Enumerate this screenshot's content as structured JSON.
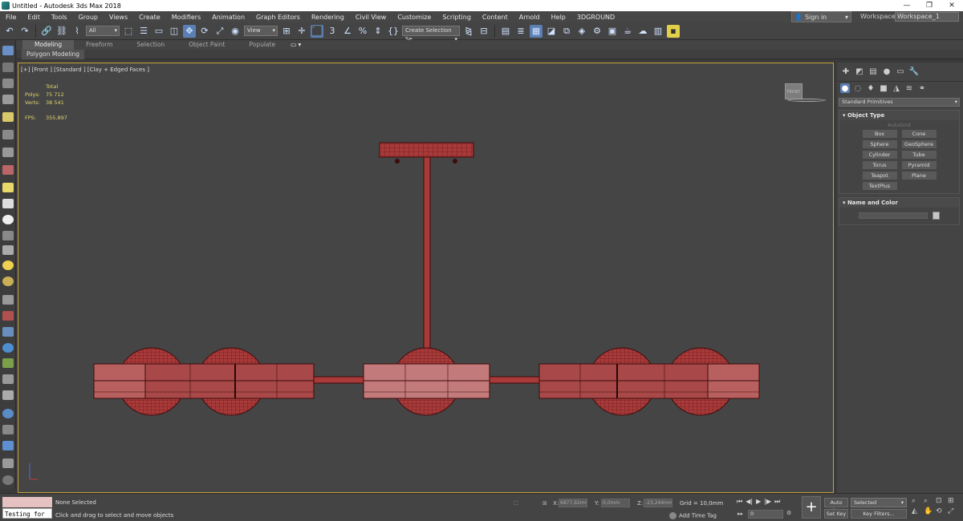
{
  "window": {
    "title": "Untitled - Autodesk 3ds Max 2018"
  },
  "menu": {
    "items": [
      "File",
      "Edit",
      "Tools",
      "Group",
      "Views",
      "Create",
      "Modifiers",
      "Animation",
      "Graph Editors",
      "Rendering",
      "Civil View",
      "Customize",
      "Scripting",
      "Content",
      "Arnold",
      "Help",
      "3DGROUND"
    ],
    "sign_in": "Sign in",
    "workspaces_label": "Workspaces:",
    "workspace_value": "Workspace_1"
  },
  "toolbar": {
    "selection_filter": "All",
    "ref_coord": "View",
    "selection_set_placeholder": "Create Selection Se",
    "snap_3": "3",
    "percent": "%"
  },
  "ribbon": {
    "tabs": [
      "Modeling",
      "Freeform",
      "Selection",
      "Object Paint",
      "Populate"
    ],
    "active_panel": "Polygon Modeling"
  },
  "viewport": {
    "label": "[+] [Front ] [Standard ] [Clay + Edged Faces ]",
    "stats": {
      "total_label": "Total",
      "polys_label": "Polys:",
      "polys_value": "75 712",
      "verts_label": "Verts:",
      "verts_value": "38 541",
      "fps_label": "FPS:",
      "fps_value": "355,897"
    },
    "viewcube_label": "FRONT"
  },
  "command_panel": {
    "category": "Standard Primitives",
    "object_type_title": "Object Type",
    "autogrid": "AutoGrid",
    "primitives": [
      "Box",
      "Cone",
      "Sphere",
      "GeoSphere",
      "Cylinder",
      "Tube",
      "Torus",
      "Pyramid",
      "Teapot",
      "Plane",
      "TextPlus"
    ],
    "name_color_title": "Name and Color"
  },
  "status": {
    "listener_text": "Testing for ;",
    "selection": "None Selected",
    "prompt": "Click and drag to select and move objects",
    "x_label": "X:",
    "x_value": "6877,92mm",
    "y_label": "Y:",
    "y_value": "0,0mm",
    "z_label": "Z:",
    "z_value": "-23,244mm",
    "grid": "Grid = 10,0mm",
    "add_time_tag": "Add Time Tag",
    "frame": "0",
    "auto_key": "Auto Key",
    "set_key": "Set Key",
    "selected_dd": "Selected",
    "key_filters": "Key Filters..."
  },
  "colors": {
    "accent": "#5b7fb3",
    "viewport_border": "#c7a33c",
    "model_fill": "#a83a3a",
    "model_wire": "#4a0f0f"
  }
}
